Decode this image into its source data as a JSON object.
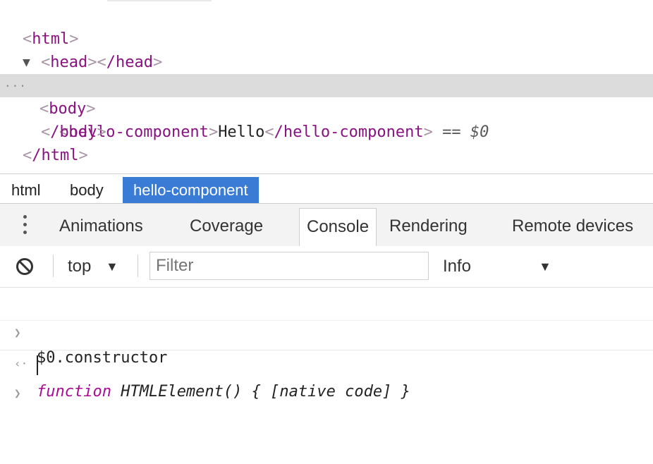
{
  "elements": {
    "html_open": {
      "lt": "<",
      "name": "html",
      "gt": ">"
    },
    "head": {
      "open": "head",
      "close": "/head"
    },
    "body_open": {
      "lt": "<",
      "name": "body",
      "gt": ">"
    },
    "selected": {
      "ellipsis": "...",
      "open_tag": "hello-component",
      "text": "Hello",
      "close_tag": "/hello-component",
      "eq": "==",
      "ref": "$0"
    },
    "body_close": "/body",
    "html_close": "/html"
  },
  "breadcrumbs": [
    "html",
    "body",
    "hello-component"
  ],
  "drawer_tabs": [
    "Animations",
    "Coverage",
    "Console",
    "Rendering",
    "Remote devices"
  ],
  "console_toolbar": {
    "context": "top",
    "filter_placeholder": "Filter",
    "level": "Info"
  },
  "console": {
    "input": "$0.constructor",
    "output_keyword": "function",
    "output_rest": "HTMLElement() { [native code] }"
  },
  "icons": [
    "more-vertical-icon",
    "clear-console-icon",
    "dropdown-arrow-icon",
    "prompt-chevron-icon"
  ],
  "colors": {
    "tag": "#881280",
    "active_crumb": "#3a7bd5",
    "selection": "#dcdcdc",
    "prompt": "#2a74d8"
  }
}
